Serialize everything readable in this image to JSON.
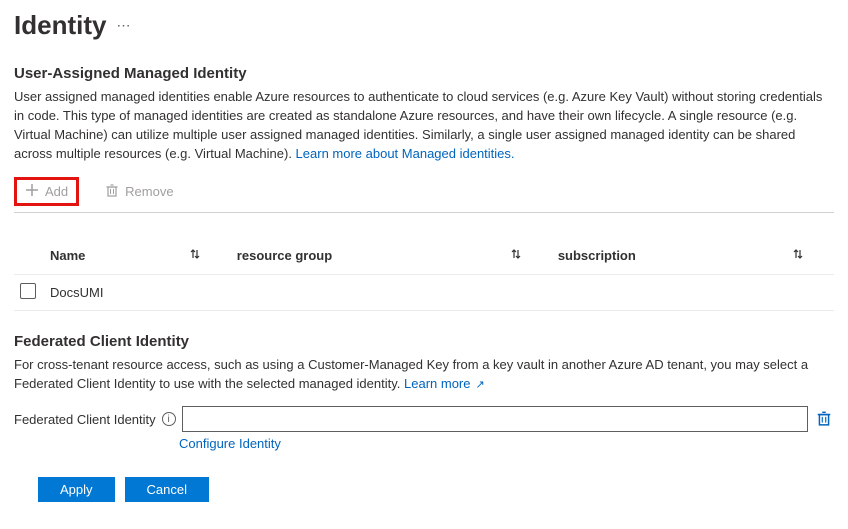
{
  "page": {
    "title": "Identity"
  },
  "section1": {
    "heading": "User-Assigned Managed Identity",
    "desc": "User assigned managed identities enable Azure resources to authenticate to cloud services (e.g. Azure Key Vault) without storing credentials in code. This type of managed identities are created as standalone Azure resources, and have their own lifecycle. A single resource (e.g. Virtual Machine) can utilize multiple user assigned managed identities. Similarly, a single user assigned managed identity can be shared across multiple resources (e.g. Virtual Machine). ",
    "learn_link": "Learn more about Managed identities."
  },
  "toolbar": {
    "add": "Add",
    "remove": "Remove"
  },
  "table": {
    "cols": {
      "name": "Name",
      "rg": "resource group",
      "sub": "subscription"
    },
    "rows": [
      {
        "name": "DocsUMI"
      }
    ]
  },
  "section2": {
    "heading": "Federated Client Identity",
    "desc": "For cross-tenant resource access, such as using a Customer-Managed Key from a key vault in another Azure AD tenant, you may select a Federated Client Identity to use with the selected managed identity. ",
    "learn_link": "Learn more",
    "field_label": "Federated Client Identity",
    "configure_link": "Configure Identity"
  },
  "footer": {
    "apply": "Apply",
    "cancel": "Cancel"
  }
}
